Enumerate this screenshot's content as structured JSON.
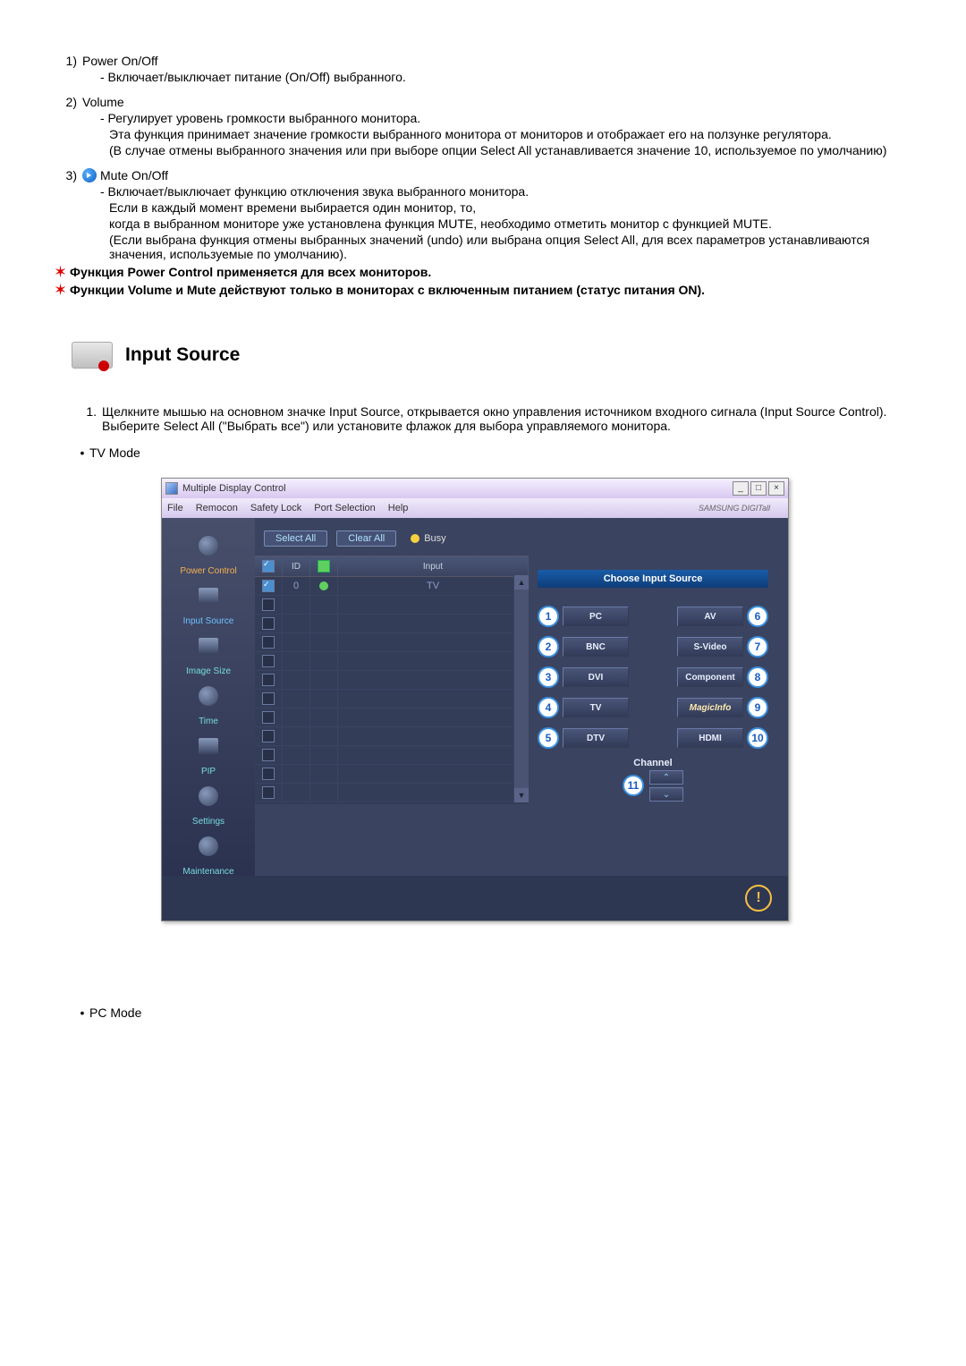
{
  "items": {
    "n1": "1)",
    "n2": "2)",
    "n3": "3)",
    "t1": "Power On/Off",
    "t1a": "- Включает/выключает питание (On/Off) выбранного.",
    "t2": "Volume",
    "t2a": "- Регулирует уровень громкости выбранного монитора.",
    "t2b": "Эта функция принимает значение громкости выбранного монитора от мониторов и отображает его на ползунке регулятора.",
    "t2c": "(В случае отмены выбранного значения или при выборе опции Select All устанавливается значение 10, используемое по умолчанию)",
    "t3": "Mute On/Off",
    "t3a": "- Включает/выключает функцию отключения звука выбранного монитора.",
    "t3b": "Если в каждый момент времени выбирается один монитор, то,",
    "t3c": "когда в выбранном мониторе уже установлена функция MUTE, необходимо отметить монитор с функцией MUTE.",
    "t3d": "(Если выбрана функция отмены выбранных значений (undo) или выбрана опция Select All, для всех параметров устанавливаются значения, используемые по умолчанию).",
    "star1": "Функция Power Control применяется для всех мониторов.",
    "star2": "Функции Volume и Mute действуют только в мониторах с включенным питанием (статус питания ON)."
  },
  "section": {
    "title": "Input Source",
    "p1n": "1.",
    "p1a": "Щелкните мышью на основном значке Input Source, открывается окно управления источником входного сигнала (Input Source Control).",
    "p1b": "Выберите Select All (\"Выбрать все\") или установите флажок для выбора управляемого монитора.",
    "b1": "TV Mode",
    "b2": "PC Mode"
  },
  "shot": {
    "title": "Multiple Display Control",
    "menu": {
      "file": "File",
      "remocon": "Remocon",
      "safety": "Safety Lock",
      "port": "Port Selection",
      "help": "Help",
      "brand": "SAMSUNG DIGITall"
    },
    "side": {
      "power": "Power Control",
      "input": "Input Source",
      "image": "Image Size",
      "time": "Time",
      "pip": "PIP",
      "settings": "Settings",
      "maint": "Maintenance"
    },
    "toolbar": {
      "select": "Select All",
      "clear": "Clear All",
      "busy": "Busy"
    },
    "grid": {
      "h2": "ID",
      "h4": "Input",
      "id0": "0",
      "val0": "TV"
    },
    "panel": {
      "head": "Choose Input Source",
      "pc": "PC",
      "av": "AV",
      "bnc": "BNC",
      "sv": "S-Video",
      "dvi": "DVI",
      "comp": "Component",
      "tv": "TV",
      "magic": "MagicInfo",
      "dtv": "DTV",
      "hdmi": "HDMI",
      "n1": "1",
      "n2": "2",
      "n3": "3",
      "n4": "4",
      "n5": "5",
      "n6": "6",
      "n7": "7",
      "n8": "8",
      "n9": "9",
      "n10": "10",
      "n11": "11",
      "channel": "Channel"
    }
  }
}
